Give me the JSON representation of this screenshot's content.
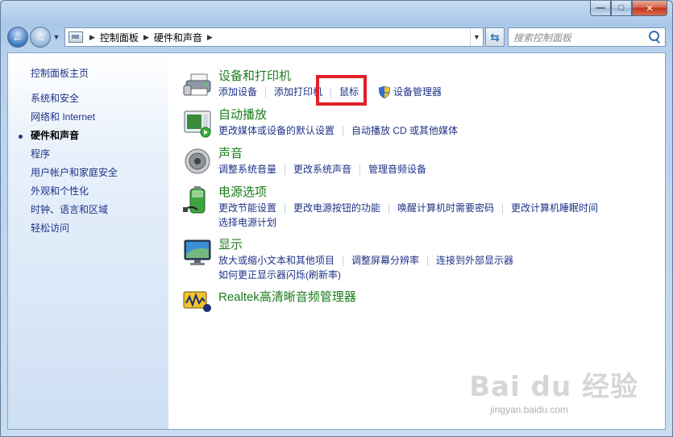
{
  "window": {
    "caption": {
      "minimize": "—",
      "maximize": "□",
      "close": "✕"
    }
  },
  "navbar": {
    "breadcrumb": [
      "控制面板",
      "硬件和声音"
    ],
    "search_placeholder": "搜索控制面板"
  },
  "sidebar": {
    "home": "控制面板主页",
    "items": [
      {
        "label": "系统和安全",
        "active": false
      },
      {
        "label": "网络和 Internet",
        "active": false
      },
      {
        "label": "硬件和声音",
        "active": true
      },
      {
        "label": "程序",
        "active": false
      },
      {
        "label": "用户帐户和家庭安全",
        "active": false
      },
      {
        "label": "外观和个性化",
        "active": false
      },
      {
        "label": "时钟、语言和区域",
        "active": false
      },
      {
        "label": "轻松访问",
        "active": false
      }
    ]
  },
  "categories": [
    {
      "title": "设备和打印机",
      "icon": "printer-icon",
      "links": [
        "添加设备",
        "添加打印机",
        "鼠标",
        "设备管理器"
      ]
    },
    {
      "title": "自动播放",
      "icon": "autoplay-icon",
      "links": [
        "更改媒体或设备的默认设置",
        "自动播放 CD 或其他媒体"
      ]
    },
    {
      "title": "声音",
      "icon": "speaker-icon",
      "links": [
        "调整系统音量",
        "更改系统声音",
        "管理音频设备"
      ]
    },
    {
      "title": "电源选项",
      "icon": "battery-icon",
      "links": [
        "更改节能设置",
        "更改电源按钮的功能",
        "唤醒计算机时需要密码",
        "更改计算机睡眠时间",
        "选择电源计划"
      ]
    },
    {
      "title": "显示",
      "icon": "monitor-icon",
      "links": [
        "放大或缩小文本和其他项目",
        "调整屏幕分辨率",
        "连接到外部显示器",
        "如何更正显示器闪烁(刷新率)"
      ]
    },
    {
      "title": "Realtek高清晰音频管理器",
      "icon": "realtek-audio-icon",
      "links": []
    }
  ],
  "watermark": {
    "logo": "Bai du 经验",
    "url": "jingyan.baidu.com"
  },
  "colors": {
    "link": "#1e3287",
    "category_title": "#1b7c1b",
    "highlight": "#e0202a"
  }
}
